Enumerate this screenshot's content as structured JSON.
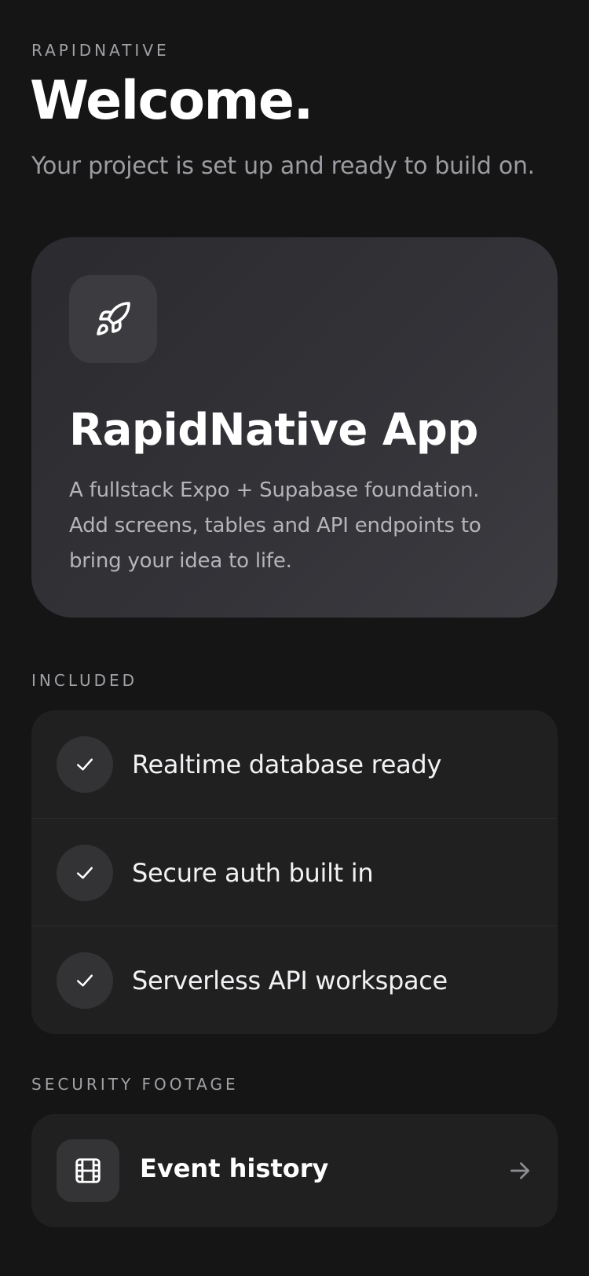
{
  "header": {
    "brand": "RAPIDNATIVE",
    "title": "Welcome.",
    "subtitle": "Your project is set up and ready to build on."
  },
  "hero": {
    "icon": "rocket-icon",
    "title": "RapidNative App",
    "description": "A fullstack Expo + Supabase foundation. Add screens, tables and API endpoints to bring your idea to life."
  },
  "included": {
    "label": "INCLUDED",
    "items": [
      {
        "label": "Realtime database ready",
        "icon": "check-icon"
      },
      {
        "label": "Secure auth built in",
        "icon": "check-icon"
      },
      {
        "label": "Serverless API workspace",
        "icon": "check-icon"
      }
    ]
  },
  "security": {
    "label": "SECURITY FOOTAGE",
    "event_history": {
      "label": "Event history",
      "icon": "film-icon",
      "action_icon": "arrow-right-icon"
    }
  },
  "colors": {
    "background": "#151516",
    "card": "#202021",
    "hero_gradient_start": "#2b2b2f",
    "hero_gradient_end": "#3c3c41",
    "muted_text": "#a1a1a6"
  }
}
